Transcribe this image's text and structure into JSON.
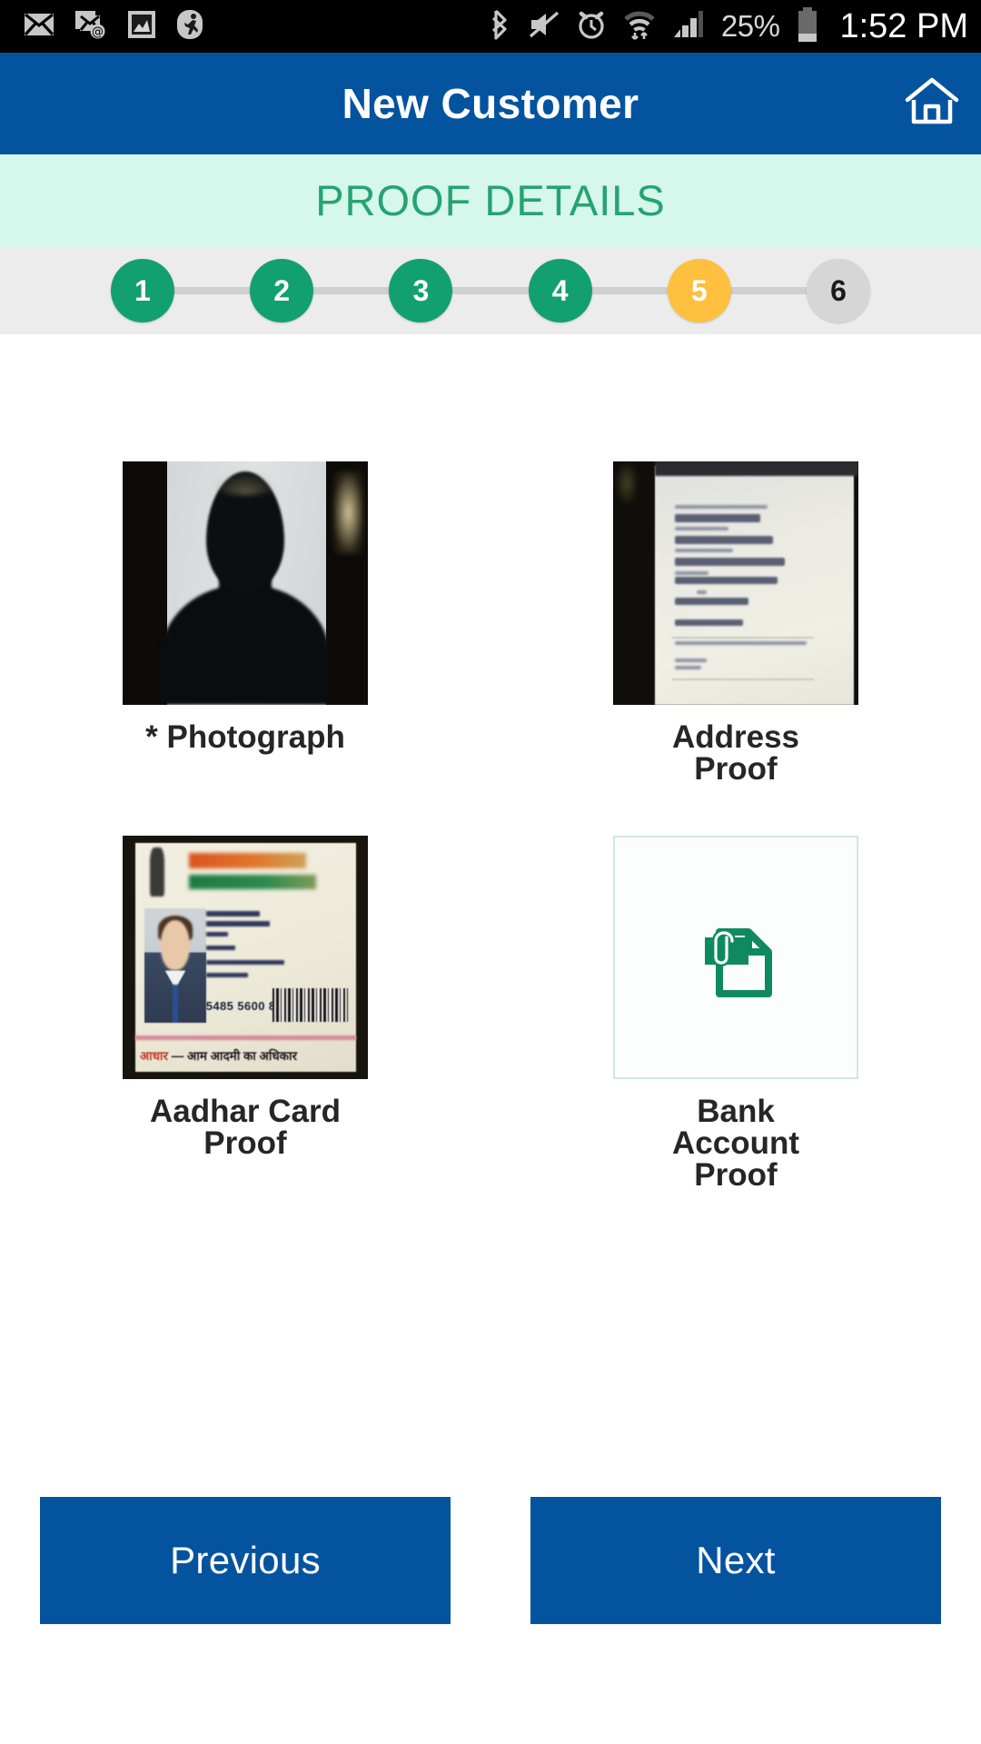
{
  "statusbar": {
    "icons": [
      {
        "name": "mail-icon"
      },
      {
        "name": "email-at-icon"
      },
      {
        "name": "gallery-image-icon"
      },
      {
        "name": "shealth-running-icon"
      },
      {
        "name": "bluetooth-icon"
      },
      {
        "name": "sound-mute-icon"
      },
      {
        "name": "alarm-clock-icon"
      },
      {
        "name": "wifi-data-transfer-icon"
      },
      {
        "name": "cellular-signal-icon"
      }
    ],
    "battery_percent": "25%",
    "clock": "1:52 PM"
  },
  "appbar": {
    "title": "New Customer",
    "home_icon": "home-icon",
    "background_color": "#04539F"
  },
  "section": {
    "title": "PROOF DETAILS",
    "background_color": "#D6F7EC",
    "text_color": "#26A372"
  },
  "stepper": {
    "steps": [
      {
        "label": "1",
        "state": "done"
      },
      {
        "label": "2",
        "state": "done"
      },
      {
        "label": "3",
        "state": "done"
      },
      {
        "label": "4",
        "state": "done"
      },
      {
        "label": "5",
        "state": "active"
      },
      {
        "label": "6",
        "state": "todo"
      }
    ],
    "done_color": "#12A071",
    "active_color": "#FFC040",
    "todo_color": "#D6D6D6",
    "track_color": "#CFCFCF",
    "background_color": "#ECECEC"
  },
  "proofs": [
    {
      "label": "* Photograph",
      "required": true,
      "state": "uploaded",
      "thumb_kind": "photograph"
    },
    {
      "label": "Address\nProof",
      "required": false,
      "state": "uploaded",
      "thumb_kind": "document"
    },
    {
      "label": "Aadhar Card\nProof",
      "required": false,
      "state": "uploaded",
      "thumb_kind": "aadhar"
    },
    {
      "label": "Bank\nAccount\nProof",
      "required": false,
      "state": "empty",
      "thumb_kind": "upload-placeholder",
      "upload_icon": "attach-document-icon"
    }
  ],
  "aadhar_thumb": {
    "number": "5485 5600 8000",
    "slogan_prefix": "आधार",
    "slogan_dash": " — ",
    "slogan_text": "आम आदमी का अधिकार"
  },
  "buttons": {
    "previous_label": "Previous",
    "next_label": "Next",
    "color": "#04539F"
  }
}
